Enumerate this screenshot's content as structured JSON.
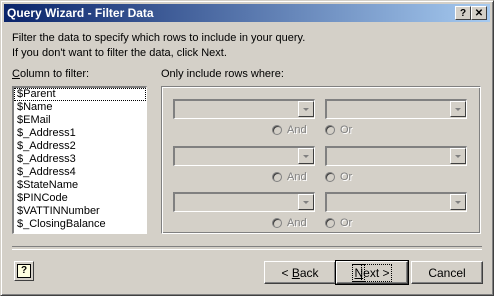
{
  "window": {
    "title": "Query Wizard - Filter Data",
    "help_button": "?",
    "close_button": "✕"
  },
  "instructions": {
    "line1": "Filter the data to specify which rows to include in your query.",
    "line2": "If you don't want to filter the data, click Next."
  },
  "column_list": {
    "label_first": "C",
    "label_rest": "olumn to filter:",
    "items": [
      "$Parent",
      "$Name",
      "$EMail",
      "$_Address1",
      "$_Address2",
      "$_Address3",
      "$_Address4",
      "$StateName",
      "$PINCode",
      "$VATTINNumber",
      "$_ClosingBalance"
    ],
    "selected": "$Parent"
  },
  "filter": {
    "label": "Only include rows where:",
    "and_label": "And",
    "or_label": "Or",
    "rows": [
      {
        "operator": "",
        "value": ""
      },
      {
        "operator": "",
        "value": ""
      },
      {
        "operator": "",
        "value": ""
      }
    ]
  },
  "buttons": {
    "back_first": "< ",
    "back_hot": "B",
    "back_rest": "ack",
    "next_hot": "N",
    "next_rest": "ext >",
    "cancel": "Cancel"
  },
  "help_icon": "?",
  "icons": [
    "help-icon",
    "close-icon",
    "chevron-down-icon"
  ]
}
